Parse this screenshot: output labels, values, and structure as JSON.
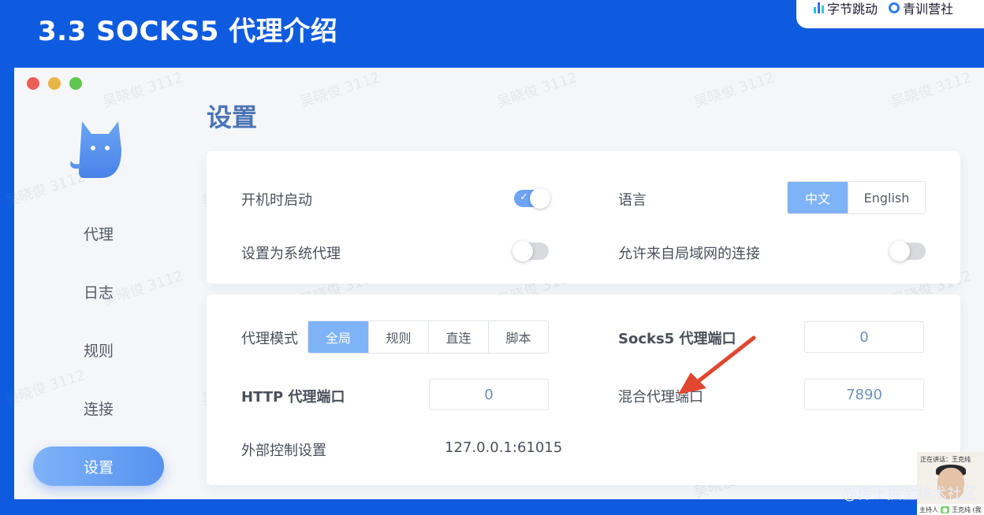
{
  "slide": {
    "title": "3.3 SOCKS5 代理介绍",
    "brands": [
      "字节跳动",
      "青训营社"
    ]
  },
  "sidebar": {
    "items": [
      {
        "label": "代理"
      },
      {
        "label": "日志"
      },
      {
        "label": "规则"
      },
      {
        "label": "连接"
      },
      {
        "label": "设置"
      }
    ],
    "active": "设置"
  },
  "page": {
    "title": "设置"
  },
  "general": {
    "start_at_login_label": "开机时启动",
    "start_at_login": true,
    "system_proxy_label": "设置为系统代理",
    "system_proxy": false,
    "language_label": "语言",
    "language_options": [
      "中文",
      "English"
    ],
    "language_selected": "中文",
    "allow_lan_label": "允许来自局域网的连接",
    "allow_lan": false
  },
  "proxy": {
    "mode_label": "代理模式",
    "mode_options": [
      "全局",
      "规则",
      "直连",
      "脚本"
    ],
    "mode_selected": "全局",
    "socks5_port_label": "Socks5 代理端口",
    "socks5_port": "0",
    "http_port_label": "HTTP 代理端口",
    "http_port": "0",
    "mixed_port_label": "混合代理端口",
    "mixed_port": "7890",
    "external_controller_label": "外部控制设置",
    "external_controller": "127.0.0.1:61015"
  },
  "watermark": "吴晓俊 3112",
  "video": {
    "speaking": "正在讲话：王克纯",
    "host_tag": "主持人",
    "name": "王克纯 (我"
  },
  "community_credit": "@稀土掘金技术社区",
  "colors": {
    "slide_bg": "#0f5be0",
    "accent": "#7fb3f8",
    "title_blue": "#4c75b5",
    "arrow": "#e1462e"
  }
}
